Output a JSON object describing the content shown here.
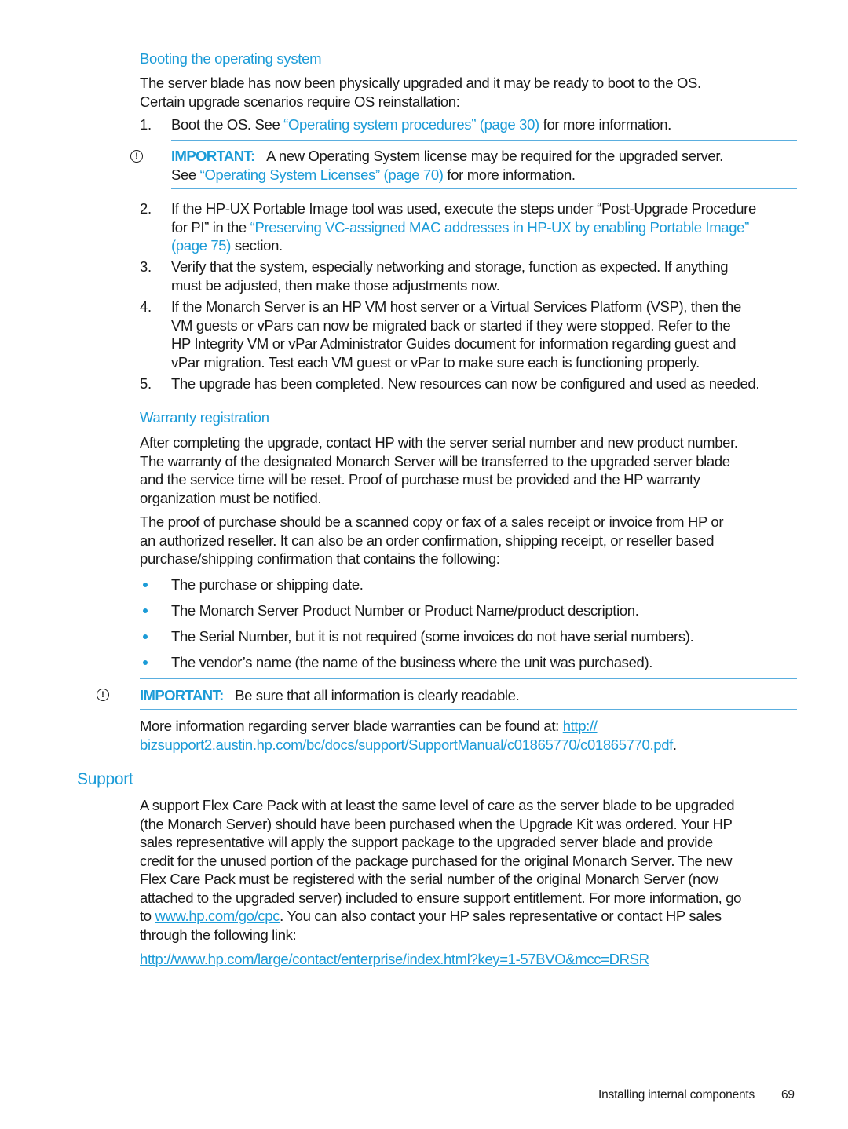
{
  "booting": {
    "heading": "Booting the operating system",
    "intro_l1": "The server blade has now been physically upgraded and it may be ready to boot to the OS.",
    "intro_l2": "Certain upgrade scenarios require OS reinstallation:",
    "step1": {
      "num": "1.",
      "pre": "Boot the OS. See ",
      "link": "“Operating system procedures” (page 30)",
      "post": " for more information."
    },
    "important1": {
      "label": "IMPORTANT:",
      "l1": "A new Operating System license may be required for the upgraded server.",
      "l2_pre": "See ",
      "l2_link": "“Operating System Licenses” (page 70)",
      "l2_post": " for more information."
    },
    "step2": {
      "num": "2.",
      "l1": "If the HP-UX Portable Image tool was used, execute the steps under “Post-Upgrade Procedure",
      "l2_pre": "for PI” in the ",
      "l2_link": "“Preserving VC-assigned MAC addresses in HP-UX by enabling Portable Image”",
      "l3_link": "(page 75)",
      "l3_post": " section."
    },
    "step3": {
      "num": "3.",
      "l1": "Verify that the system, especially networking and storage, function as expected. If anything",
      "l2": "must be adjusted, then make those adjustments now."
    },
    "step4": {
      "num": "4.",
      "l1": "If the Monarch Server is an HP VM host server or a Virtual Services Platform (VSP), then the",
      "l2": "VM guests or vPars can now be migrated back or started if they were stopped. Refer to the",
      "l3": "HP Integrity VM or vPar Administrator Guides document for information regarding guest and",
      "l4": "vPar migration. Test each VM guest or vPar to make sure each is functioning properly."
    },
    "step5": {
      "num": "5.",
      "l1": "The upgrade has been completed. New resources can now be configured and used as needed."
    }
  },
  "warranty": {
    "heading": "Warranty registration",
    "p1": [
      "After completing the upgrade, contact HP with the server serial number and new product number.",
      "The warranty of the designated Monarch Server will be transferred to the upgraded server blade",
      "and the service time will be reset. Proof of purchase must be provided and the HP warranty",
      "organization must be notified."
    ],
    "p2": [
      "The proof of purchase should be a scanned copy or fax of a sales receipt or invoice from HP or",
      "an authorized reseller. It can also be an order confirmation, shipping receipt, or reseller based",
      "purchase/shipping confirmation that contains the following:"
    ],
    "bullets": [
      "The purchase or shipping date.",
      "The Monarch Server Product Number or Product Name/product description.",
      "The Serial Number, but it is not required (some invoices do not have serial numbers).",
      "The vendor’s name (the name of the business where the unit was purchased)."
    ],
    "important2": {
      "label": "IMPORTANT:",
      "text": "Be sure that all information is clearly readable."
    },
    "more_pre": "More information regarding server blade warranties can be found at: ",
    "more_link_l1": "http://",
    "more_link_l2": "bizsupport2.austin.hp.com/bc/docs/support/SupportManual/c01865770/c01865770.pdf",
    "more_post": "."
  },
  "support": {
    "heading": "Support",
    "lines": [
      "A support Flex Care Pack with at least the same level of care as the server blade to be upgraded",
      "(the Monarch Server) should have been purchased when the Upgrade Kit was ordered. Your HP",
      "sales representative will apply the support package to the upgraded server blade and provide",
      "credit for the unused portion of the package purchased for the original Monarch Server. The new",
      "Flex Care Pack must be registered with the serial number of the original Monarch Server (now",
      "attached to the upgraded server) included to ensure support entitlement. For more information, go"
    ],
    "l7_pre": "to ",
    "l7_link": "www.hp.com/go/cpc",
    "l7_post": ". You can also contact your HP sales representative or contact HP sales",
    "l8": "through the following link:",
    "contact_link": "http://www.hp.com/large/contact/enterprise/index.html?key=1-57BVO&mcc=DRSR"
  },
  "footer": {
    "section": "Installing internal components",
    "page": "69"
  },
  "icons": {
    "important": "!"
  }
}
